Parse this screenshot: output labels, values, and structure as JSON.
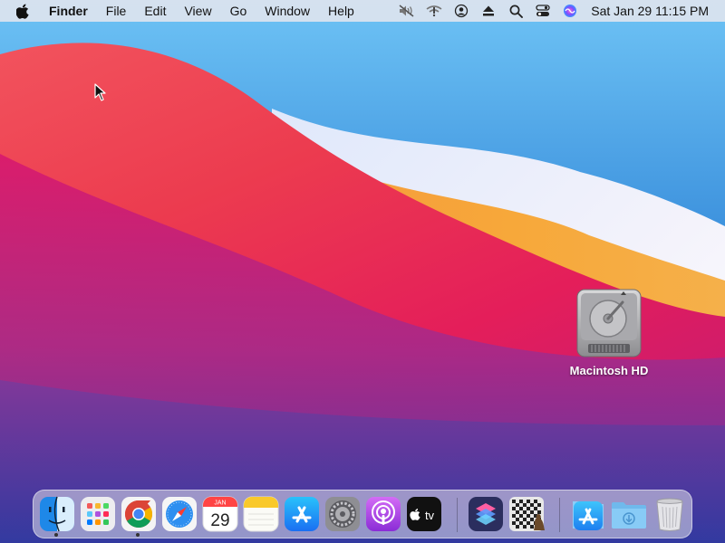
{
  "menubar": {
    "apple_icon": "apple-logo-icon",
    "app_name": "Finder",
    "menus": [
      "File",
      "Edit",
      "View",
      "Go",
      "Window",
      "Help"
    ],
    "status_icons": [
      "mute-icon",
      "wifi-icon",
      "user-icon",
      "eject-icon",
      "search-icon",
      "control-center-icon",
      "siri-icon"
    ],
    "clock": "Sat Jan 29  11:15 PM"
  },
  "desktop": {
    "drive_label": "Macintosh HD",
    "wallpaper": "macOS Big Sur"
  },
  "dock": {
    "apps": [
      {
        "name": "Finder",
        "icon": "finder-icon",
        "running": true
      },
      {
        "name": "Launchpad",
        "icon": "launchpad-icon",
        "running": false
      },
      {
        "name": "Google Chrome",
        "icon": "chrome-icon",
        "running": true
      },
      {
        "name": "Safari",
        "icon": "safari-icon",
        "running": false
      },
      {
        "name": "Calendar",
        "icon": "calendar-icon",
        "running": false,
        "month": "JAN",
        "day": "29"
      },
      {
        "name": "Notes",
        "icon": "notes-icon",
        "running": false
      },
      {
        "name": "App Store",
        "icon": "app-store-icon",
        "running": false
      },
      {
        "name": "System Preferences",
        "icon": "system-preferences-icon",
        "running": false
      },
      {
        "name": "Podcasts",
        "icon": "podcasts-icon",
        "running": false
      },
      {
        "name": "TV",
        "icon": "apple-tv-icon",
        "running": false,
        "label": "tv"
      },
      {
        "name": "Shortcuts",
        "icon": "shortcuts-icon",
        "running": false
      },
      {
        "name": "Chess",
        "icon": "chess-icon",
        "running": false
      },
      {
        "name": "Applications",
        "icon": "applications-folder-icon",
        "running": false
      },
      {
        "name": "Downloads",
        "icon": "downloads-folder-icon",
        "running": false
      },
      {
        "name": "Trash",
        "icon": "trash-icon",
        "running": false
      }
    ]
  }
}
